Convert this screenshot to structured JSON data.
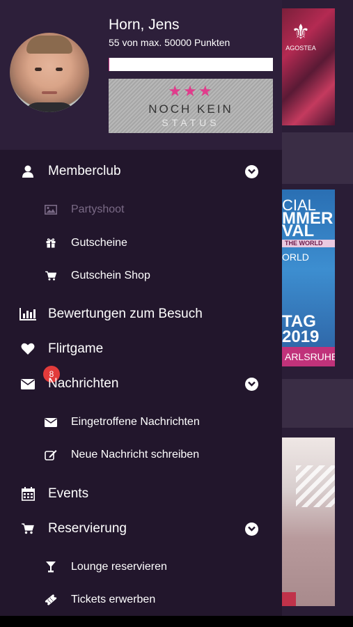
{
  "profile": {
    "name": "Horn, Jens",
    "points_text": "55  von max. 50000 Punkten",
    "progress_fraction": 0.0011,
    "status_stars": "★★★",
    "status_line1": "NOCH KEIN",
    "status_line2": "STATUS"
  },
  "menu": {
    "memberclub": "Memberclub",
    "partyshoot": "Partyshoot",
    "gutscheine": "Gutscheine",
    "gutschein_shop": "Gutschein Shop",
    "bewertungen": "Bewertungen zum Besuch",
    "flirtgame": "Flirtgame",
    "nachrichten": "Nachrichten",
    "nachrichten_badge": "8",
    "eingetroffene": "Eingetroffene Nachrichten",
    "neue_nachricht": "Neue Nachricht schreiben",
    "events": "Events",
    "reservierung": "Reservierung",
    "lounge": "Lounge reservieren",
    "tickets": "Tickets erwerben"
  },
  "background": {
    "card1_logo": "AGOSTEA",
    "card2_lines": [
      "CIAL",
      "MMER",
      "VAL",
      "THE WORLD",
      "ORLD",
      "TAG",
      "2019"
    ],
    "card2_footer": "ARLSRUHE"
  },
  "colors": {
    "drawer_bg": "#22162c",
    "profile_bg": "#2d1f3a",
    "badge": "#e23b3b",
    "star": "#e03c8c"
  }
}
